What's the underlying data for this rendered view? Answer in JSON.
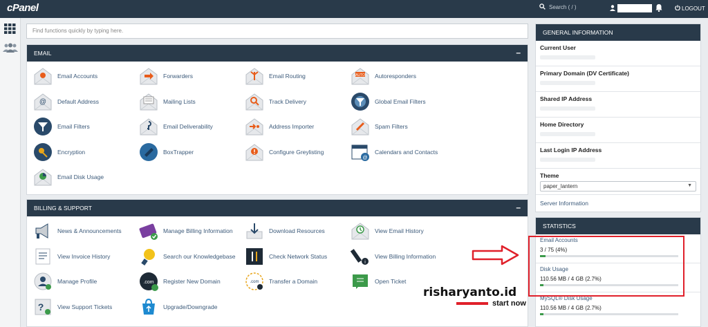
{
  "header": {
    "logo": "cPanel",
    "search_placeholder": "Search ( / )",
    "logout_label": "LOGOUT"
  },
  "find": {
    "placeholder": "Find functions quickly by typing here."
  },
  "email": {
    "title": "EMAIL",
    "items": [
      {
        "label": "Email Accounts",
        "icon": "email-accounts-icon"
      },
      {
        "label": "Forwarders",
        "icon": "forwarders-icon"
      },
      {
        "label": "Email Routing",
        "icon": "email-routing-icon"
      },
      {
        "label": "Autoresponders",
        "icon": "autoresponders-icon"
      },
      {
        "label": "Default Address",
        "icon": "default-address-icon"
      },
      {
        "label": "Mailing Lists",
        "icon": "mailing-lists-icon"
      },
      {
        "label": "Track Delivery",
        "icon": "track-delivery-icon"
      },
      {
        "label": "Global Email Filters",
        "icon": "global-email-filters-icon"
      },
      {
        "label": "Email Filters",
        "icon": "email-filters-icon"
      },
      {
        "label": "Email Deliverability",
        "icon": "email-deliverability-icon"
      },
      {
        "label": "Address Importer",
        "icon": "address-importer-icon"
      },
      {
        "label": "Spam Filters",
        "icon": "spam-filters-icon"
      },
      {
        "label": "Encryption",
        "icon": "encryption-icon"
      },
      {
        "label": "BoxTrapper",
        "icon": "boxtrapper-icon"
      },
      {
        "label": "Configure Greylisting",
        "icon": "greylisting-icon"
      },
      {
        "label": "Calendars and Contacts",
        "icon": "calendars-contacts-icon"
      },
      {
        "label": "Email Disk Usage",
        "icon": "email-disk-usage-icon"
      }
    ]
  },
  "billing": {
    "title": "BILLING & SUPPORT",
    "items": [
      {
        "label": "News & Announcements",
        "icon": "megaphone-icon"
      },
      {
        "label": "Manage Billing Information",
        "icon": "billing-card-icon"
      },
      {
        "label": "Download Resources",
        "icon": "download-icon"
      },
      {
        "label": "View Email History",
        "icon": "email-history-icon"
      },
      {
        "label": "View Invoice History",
        "icon": "invoice-icon"
      },
      {
        "label": "Search our Knowledgebase",
        "icon": "lightbulb-icon"
      },
      {
        "label": "Check Network Status",
        "icon": "network-status-icon"
      },
      {
        "label": "View Billing Information",
        "icon": "billing-info-icon"
      },
      {
        "label": "Manage Profile",
        "icon": "profile-icon"
      },
      {
        "label": "Register New Domain",
        "icon": "register-domain-icon"
      },
      {
        "label": "Transfer a Domain",
        "icon": "transfer-domain-icon"
      },
      {
        "label": "Open Ticket",
        "icon": "ticket-icon"
      },
      {
        "label": "View Support Tickets",
        "icon": "support-tickets-icon"
      },
      {
        "label": "Upgrade/Downgrade",
        "icon": "upgrade-icon"
      }
    ]
  },
  "general_info": {
    "title": "GENERAL INFORMATION",
    "rows": [
      {
        "label": "Current User"
      },
      {
        "label": "Primary Domain (DV Certificate)"
      },
      {
        "label": "Shared IP Address"
      },
      {
        "label": "Home Directory"
      },
      {
        "label": "Last Login IP Address"
      }
    ],
    "theme_label": "Theme",
    "theme_value": "paper_lantern",
    "server_info": "Server Information"
  },
  "statistics": {
    "title": "STATISTICS",
    "items": [
      {
        "label": "Email Accounts",
        "value": "3 / 75   (4%)",
        "percent": 4
      },
      {
        "label": "Disk Usage",
        "value": "110.56 MB / 4 GB   (2.7%)",
        "percent": 2.7
      },
      {
        "label": "MySQL® Disk Usage",
        "value": "110.56 MB / 4 GB   (2.7%)",
        "percent": 2.7
      }
    ]
  },
  "watermark": {
    "name": "risharyanto.id",
    "tagline": "start now"
  },
  "colors": {
    "header": "#293a4a",
    "link": "#3c5a7a",
    "highlight": "#e0202a",
    "bar_fill": "#3c9a4a"
  }
}
